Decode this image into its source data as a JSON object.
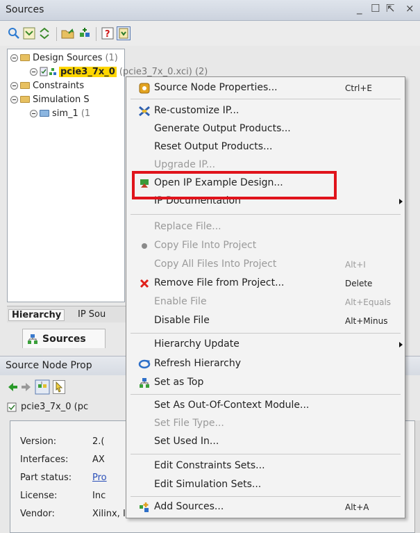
{
  "sources_panel": {
    "title": "Sources",
    "window_controls": [
      "_",
      "☐",
      "⇱",
      "×"
    ],
    "tree": {
      "design_sources": {
        "label": "Design Sources",
        "count": "(1)"
      },
      "ip_item": {
        "label": "pcie3_7x_0",
        "file": "(pcie3_7x_0.xci) (2)"
      },
      "constraints": {
        "label": "Constraints"
      },
      "simulation_sources": {
        "label": "Simulation S"
      },
      "sim_1": {
        "label": "sim_1",
        "count": "(1"
      }
    },
    "bottom_tabs": {
      "hierarchy": "Hierarchy",
      "ip_sources": "IP Sou"
    },
    "sub_tab": {
      "sources": "Sources"
    }
  },
  "properties_panel": {
    "title": "Source Node Prop",
    "object_name": "pcie3_7x_0 (pc",
    "rows": [
      {
        "label": "Version:",
        "value": "2.("
      },
      {
        "label": "Interfaces:",
        "value": "AX"
      },
      {
        "label": "Part status:",
        "value": "Pro"
      },
      {
        "label": "License:",
        "value": "Inc"
      },
      {
        "label": "Vendor:",
        "value": "Xilinx, Inc."
      }
    ]
  },
  "context_menu": {
    "items": [
      {
        "label": "Source Node Properties...",
        "shortcut": "Ctrl+E",
        "icon": "properties-icon",
        "enabled": true,
        "submenu": false
      },
      {
        "label": "Re-customize IP...",
        "shortcut": "",
        "icon": "recustomize-icon",
        "enabled": true,
        "submenu": false
      },
      {
        "label": "Generate Output Products...",
        "shortcut": "",
        "icon": "",
        "enabled": true,
        "submenu": false
      },
      {
        "label": "Reset Output Products...",
        "shortcut": "",
        "icon": "",
        "enabled": true,
        "submenu": false
      },
      {
        "label": "Upgrade IP...",
        "shortcut": "",
        "icon": "",
        "enabled": false,
        "submenu": false
      },
      {
        "label": "Open IP Example Design...",
        "shortcut": "",
        "icon": "example-design-icon",
        "enabled": true,
        "submenu": false
      },
      {
        "label": "IP Documentation",
        "shortcut": "",
        "icon": "",
        "enabled": true,
        "submenu": true
      },
      {
        "label": "Replace File...",
        "shortcut": "",
        "icon": "",
        "enabled": false,
        "submenu": false
      },
      {
        "label": "Copy File Into Project",
        "shortcut": "",
        "icon": "copy-dot-icon",
        "enabled": false,
        "submenu": false
      },
      {
        "label": "Copy All Files Into Project",
        "shortcut": "Alt+I",
        "icon": "",
        "enabled": false,
        "submenu": false
      },
      {
        "label": "Remove File from Project...",
        "shortcut": "Delete",
        "icon": "remove-x-icon",
        "enabled": true,
        "submenu": false
      },
      {
        "label": "Enable File",
        "shortcut": "Alt+Equals",
        "icon": "",
        "enabled": false,
        "submenu": false
      },
      {
        "label": "Disable File",
        "shortcut": "Alt+Minus",
        "icon": "",
        "enabled": true,
        "submenu": false
      },
      {
        "label": "Hierarchy Update",
        "shortcut": "",
        "icon": "",
        "enabled": true,
        "submenu": true
      },
      {
        "label": "Refresh Hierarchy",
        "shortcut": "",
        "icon": "refresh-icon",
        "enabled": true,
        "submenu": false
      },
      {
        "label": "Set as Top",
        "shortcut": "",
        "icon": "set-top-icon",
        "enabled": true,
        "submenu": false
      },
      {
        "label": "Set As Out-Of-Context Module...",
        "shortcut": "",
        "icon": "",
        "enabled": true,
        "submenu": false
      },
      {
        "label": "Set File Type...",
        "shortcut": "",
        "icon": "",
        "enabled": false,
        "submenu": false
      },
      {
        "label": "Set Used In...",
        "shortcut": "",
        "icon": "",
        "enabled": true,
        "submenu": false
      },
      {
        "label": "Edit Constraints Sets...",
        "shortcut": "",
        "icon": "",
        "enabled": true,
        "submenu": false
      },
      {
        "label": "Edit Simulation Sets...",
        "shortcut": "",
        "icon": "",
        "enabled": true,
        "submenu": false
      },
      {
        "label": "Add Sources...",
        "shortcut": "Alt+A",
        "icon": "add-sources-icon",
        "enabled": true,
        "submenu": false
      }
    ],
    "highlighted_item": "Open IP Example Design...",
    "highlight_color": "#e0131b"
  },
  "colors": {
    "selection_highlight": "#ffd600",
    "link": "#2a4fb8",
    "disabled_text": "#9a9a9a"
  }
}
